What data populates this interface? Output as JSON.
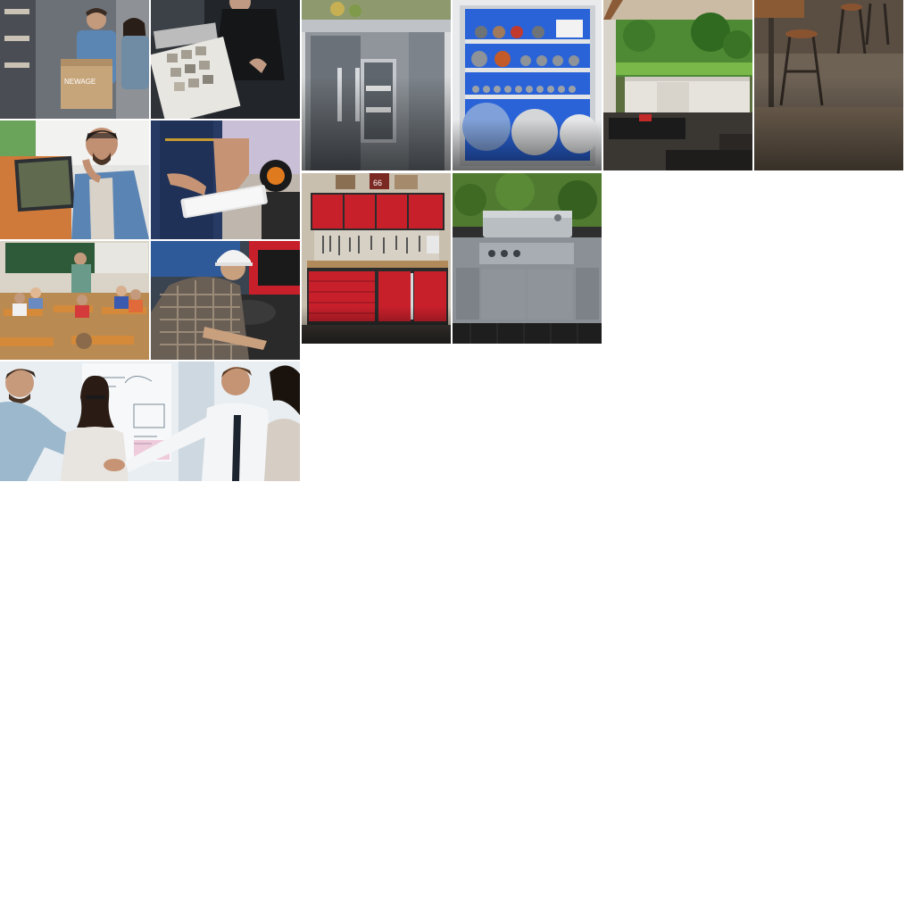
{
  "sprite": {
    "tiles": [
      {
        "id": "warehouse",
        "subject": "box-brand",
        "box_text": "NEWAGE"
      },
      {
        "id": "samples"
      },
      {
        "id": "fridge"
      },
      {
        "id": "gym"
      },
      {
        "id": "patio"
      },
      {
        "id": "bar"
      },
      {
        "id": "phone"
      },
      {
        "id": "tablet"
      },
      {
        "id": "garage",
        "sign_text": "66"
      },
      {
        "id": "grill"
      },
      {
        "id": "classroom"
      },
      {
        "id": "installer"
      },
      {
        "id": "handshake"
      }
    ]
  },
  "colors": {
    "background": "#ffffff",
    "cabinet_red": "#c8202b",
    "steel": "#9aa1a8",
    "gym_blue": "#1f5fd6",
    "lawn_green": "#5aa33c"
  }
}
